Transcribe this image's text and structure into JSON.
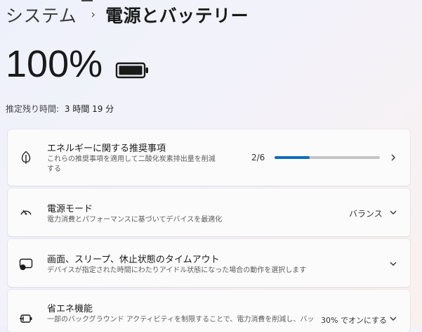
{
  "header": {
    "breadcrumb_parent": "システム",
    "breadcrumb_separator": "›",
    "page_title": "電源とバッテリー"
  },
  "battery": {
    "percent": "100%",
    "time_remaining_label": "推定残り時間:",
    "time_remaining_value": "3 時間 19 分",
    "charge_level": 1.0
  },
  "cards": [
    {
      "id": "energy-recommendations",
      "icon": "leaf-icon",
      "title": "エネルギーに関する推奨事項",
      "description_lines": [
        "これらの推奨事項を適用して二酸化炭素排出量を削減",
        "する"
      ],
      "progress_text": "2/6",
      "progress_value": 2,
      "progress_max": 6,
      "chevron": "chevron-right-icon"
    },
    {
      "id": "power-mode",
      "icon": "speedometer-icon",
      "title": "電源モード",
      "description_lines": [
        "電力消費とパフォーマンスに基づいてデバイスを最適化"
      ],
      "value": "バランス",
      "chevron": "chevron-down-icon"
    },
    {
      "id": "screen-sleep-timeouts",
      "icon": "screen-sleep-icon",
      "title": "画面、スリープ、休止状態のタイムアウト",
      "description_lines": [
        "デバイスが指定された時間にわたりアイドル状態になった場合の動作を選択します"
      ],
      "chevron": "chevron-down-icon"
    },
    {
      "id": "energy-saver",
      "icon": "battery-saver-icon",
      "title": "省エネ機能",
      "description_lines": [
        "一部のバックグラウンド アクティビティを制限することで、電力消費を削減し、バッ"
      ],
      "value": "30% でオンにする",
      "chevron": "chevron-down-icon"
    }
  ],
  "colors": {
    "accent": "#0f6cbd",
    "card_background": "#fbfbfb"
  }
}
